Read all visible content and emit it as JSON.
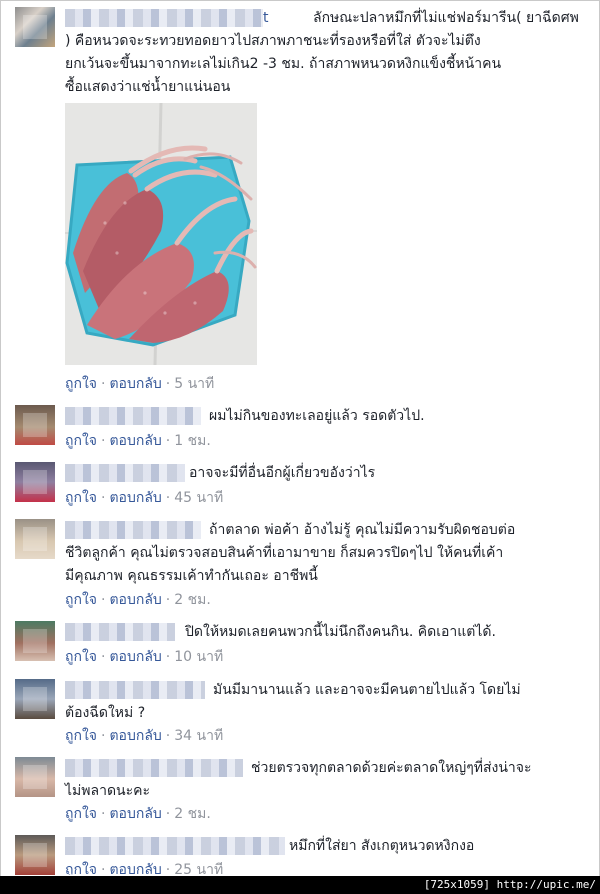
{
  "comments": [
    {
      "name_suffix": "t",
      "text": "ลักษณะปลาหมึกที่ไม่แช่ฟอร์มารีน( ยาฉีดศพ\n) คือหนวดจะระทวยทอดยาวไปสภาพภาชนะที่รองหรือที่ใส่ ตัวจะไม่ตึง\nยกเว้นจะขึ้นมาจากทะเลไม่เกิน2 -3 ชม. ถ้าสภาพหนวดหงิกแข็งชี้หน้าคน\nซื้อแสดงว่าแช่น้ำยาแน่นอน",
      "like": "ถูกใจ",
      "reply": "ตอบกลับ",
      "time": "5 นาที"
    },
    {
      "text": "ผมไม่กินของทะเลอยู่แล้ว รอดตัวไป.",
      "like": "ถูกใจ",
      "reply": "ตอบกลับ",
      "time": "1 ชม."
    },
    {
      "text": "อาจจะมีที่อื่นอีกผู้เกี่ยวขอังว่าไร",
      "like": "ถูกใจ",
      "reply": "ตอบกลับ",
      "time": "45 นาที"
    },
    {
      "text": "ถ้าตลาด พ่อค้า อ้างไม่รู้ คุณไม่มีความรับผิดชอบต่อ\nชีวิตลูกค้า คุณไม่ตรวจสอบสินค้าที่เอามาขาย ก็สมควรปิดๆไป ให้คนที่เค้า\nมีคุณภาพ คุณธรรมเค้าทำกันเถอะ อาชีพนี้",
      "like": "ถูกใจ",
      "reply": "ตอบกลับ",
      "time": "2 ชม."
    },
    {
      "text": "ปิดให้หมดเลยคนพวกนี้ไม่นึกถึงคนกิน. คิดเอาแต่ได้.",
      "like": "ถูกใจ",
      "reply": "ตอบกลับ",
      "time": "10 นาที"
    },
    {
      "text": "มันมีมานานแล้ว และอาจจะมีคนตายไปแล้ว โดยไม่\nต้องฉีดใหม่ ?",
      "like": "ถูกใจ",
      "reply": "ตอบกลับ",
      "time": "34 นาที"
    },
    {
      "text": "ช่วยตรวจทุกตลาดด้วยค่ะตลาดใหญ่ๆที่ส่งน่าจะ\nไม่พลาดนะคะ",
      "like": "ถูกใจ",
      "reply": "ตอบกลับ",
      "time": "2 ชม."
    },
    {
      "text": "หมึกที่ใส่ยา สังเกตุหนวดหงิกงอ",
      "like": "ถูกใจ",
      "reply": "ตอบกลับ",
      "time": "25 นาที"
    }
  ],
  "footer": {
    "label": "[725x1059] http://upic.me/"
  }
}
